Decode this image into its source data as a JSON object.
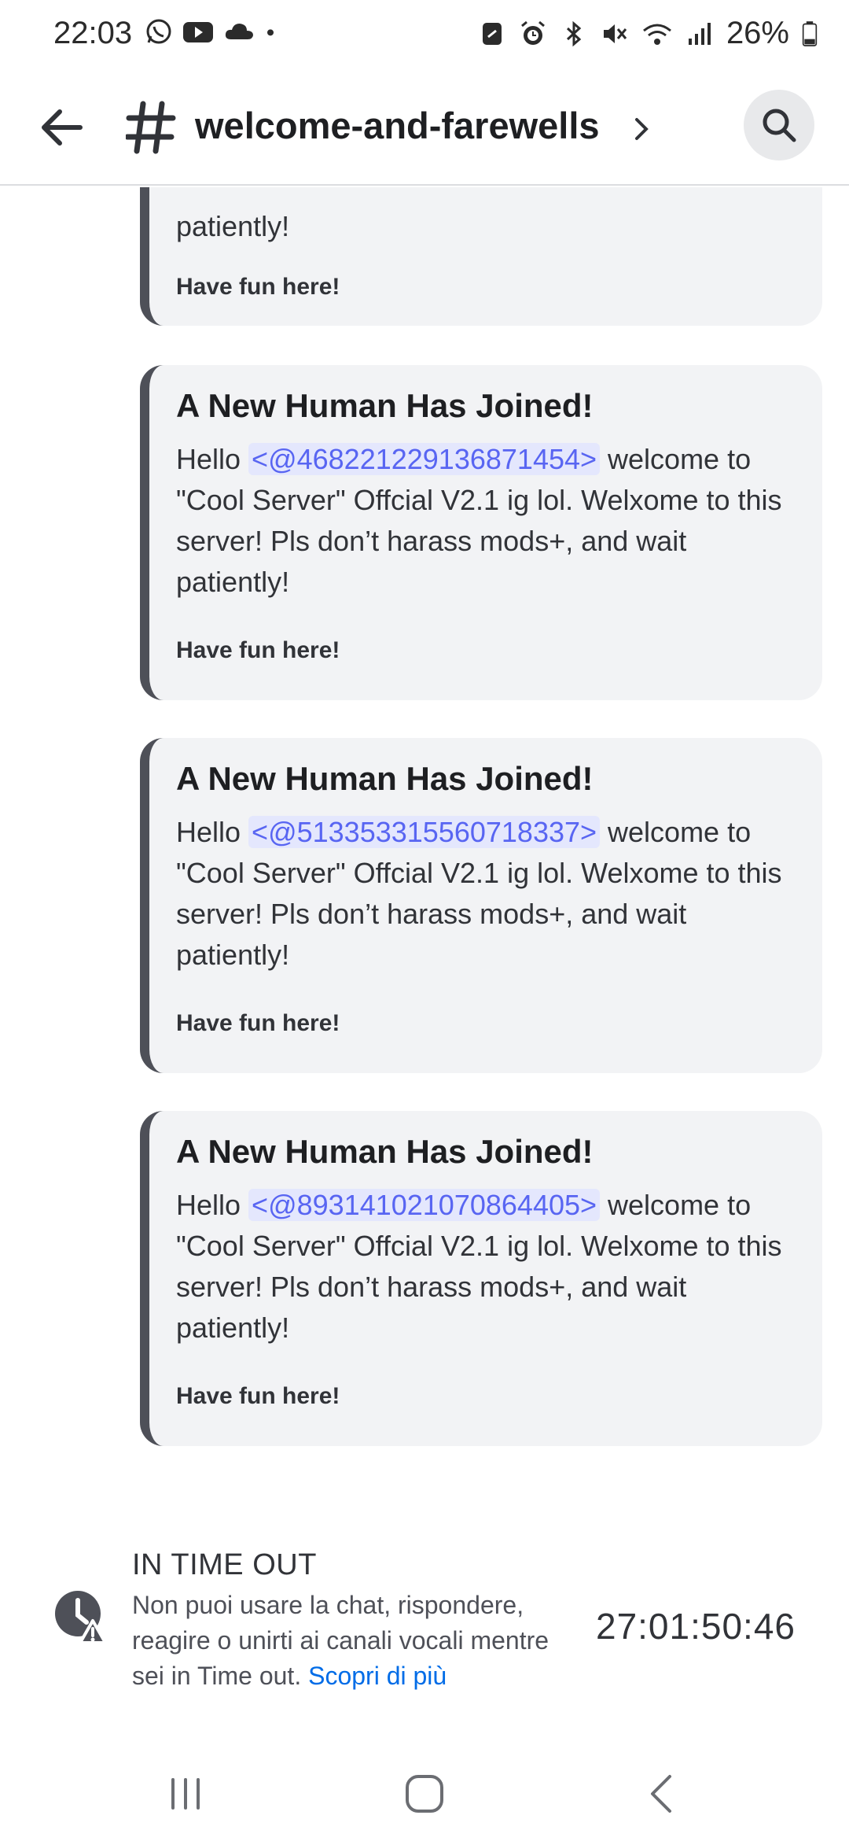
{
  "status_bar": {
    "time": "22:03",
    "battery": "26%",
    "left_icons": [
      "whatsapp-icon",
      "youtube-icon",
      "cloud-icon",
      "dot-icon"
    ],
    "right_icons": [
      "nfc-icon",
      "alarm-icon",
      "bluetooth-icon",
      "mute-icon",
      "wifi-icon",
      "signal-icon",
      "battery-icon"
    ]
  },
  "header": {
    "channel_name": "welcome-and-farewells"
  },
  "messages": [
    {
      "desc_text": "patiently!",
      "footer": "Have fun here!"
    },
    {
      "title": "A New Human Has Joined!",
      "desc_prefix": "Hello ",
      "mention": "<@468221229136871454>",
      "desc_suffix": " welcome to \"Cool Server\" Offcial V2.1 ig lol. Welxome to this server! Pls don’t harass mods+, and wait patiently!",
      "footer": "Have fun here!"
    },
    {
      "title": "A New Human Has Joined!",
      "desc_prefix": "Hello ",
      "mention": "<@513353315560718337>",
      "desc_suffix": " welcome to \"Cool Server\" Offcial V2.1 ig lol. Welxome to this server! Pls don’t harass mods+, and wait patiently!",
      "footer": "Have fun here!"
    },
    {
      "title": "A New Human Has Joined!",
      "desc_prefix": "Hello ",
      "mention": "<@893141021070864405>",
      "desc_suffix": " welcome to \"Cool Server\" Offcial V2.1 ig lol. Welxome to this server! Pls don’t harass mods+, and wait patiently!",
      "footer": "Have fun here!"
    }
  ],
  "timeout": {
    "title": "IN TIME OUT",
    "text": "Non puoi usare la chat, rispondere, reagire o unirti ai canali vocali mentre sei in Time out.",
    "link": "Scopri di più",
    "timer": "27:01:50:46"
  },
  "colors": {
    "mention": "#5865f2",
    "link": "#006ce7",
    "embed_bar": "#4e5058",
    "embed_bg": "#f2f3f5"
  }
}
